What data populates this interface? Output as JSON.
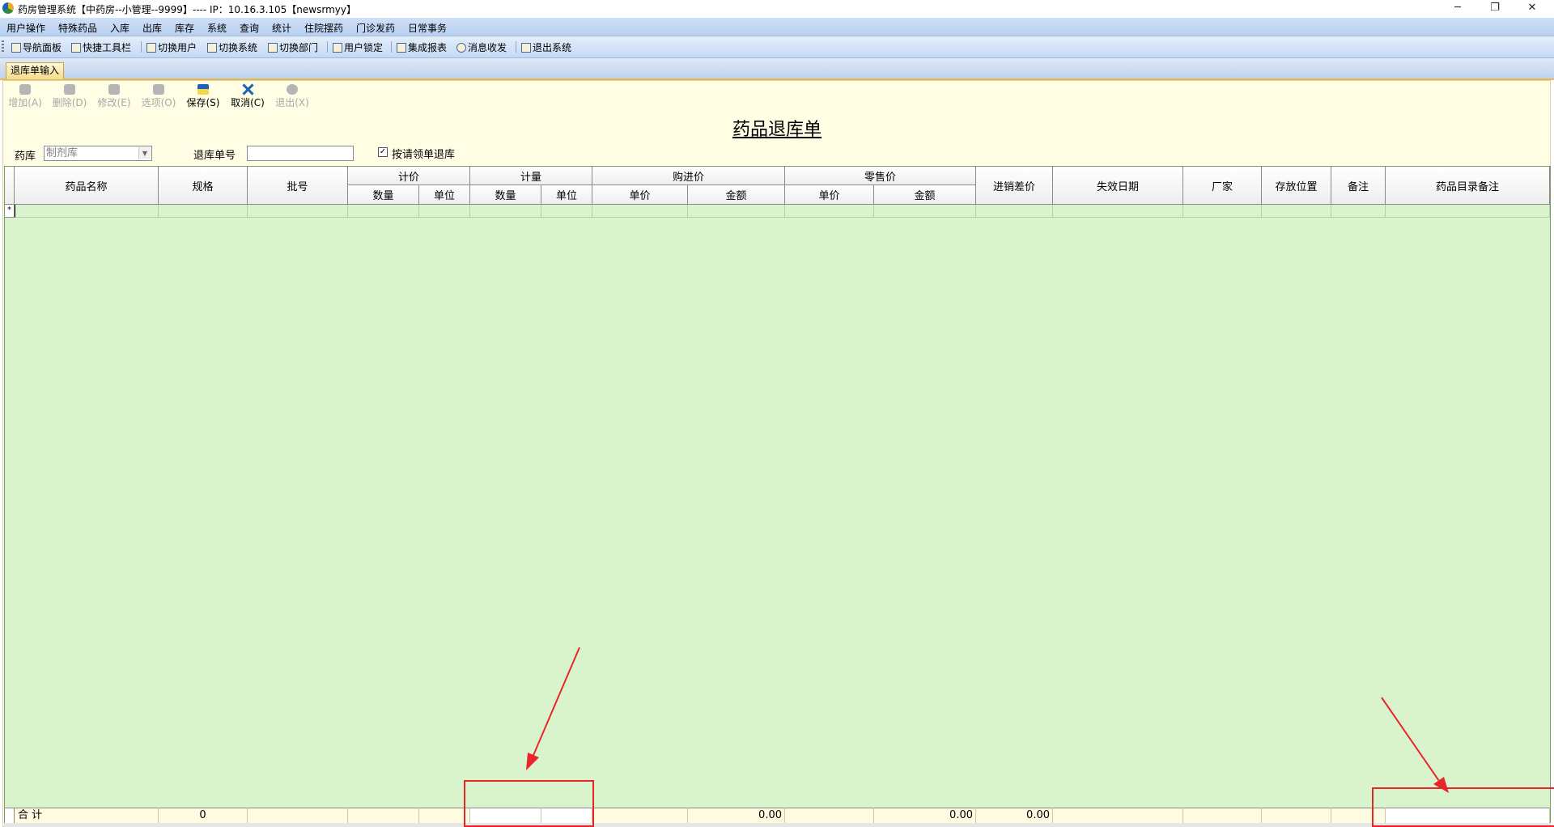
{
  "window": {
    "title": "药房管理系统【中药房--小管理--9999】---- IP：10.16.3.105【newsrmyy】",
    "controls": {
      "minimize": "─",
      "restore": "❐",
      "close": "✕"
    }
  },
  "menu": [
    "用户操作",
    "特殊药品",
    "入库",
    "出库",
    "库存",
    "系统",
    "查询",
    "统计",
    "住院摆药",
    "门诊发药",
    "日常事务"
  ],
  "toolbar": [
    "导航面板",
    "快捷工具栏",
    "切换用户",
    "切换系统",
    "切换部门",
    "用户锁定",
    "集成报表",
    "消息收发",
    "退出系统"
  ],
  "tab": {
    "label": "退库单输入"
  },
  "actions": [
    {
      "label": "增加(A)",
      "enabled": false
    },
    {
      "label": "删除(D)",
      "enabled": false
    },
    {
      "label": "修改(E)",
      "enabled": false
    },
    {
      "label": "选项(O)",
      "enabled": false
    },
    {
      "label": "保存(S)",
      "enabled": true
    },
    {
      "label": "取消(C)",
      "enabled": true
    },
    {
      "label": "退出(X)",
      "enabled": false
    }
  ],
  "form": {
    "title": "药品退库单",
    "pharmacy_label": "药库",
    "pharmacy_value": "制剂库",
    "return_no_label": "退库单号",
    "return_no_value": "",
    "by_request_label": "按请领单退库",
    "by_request_checked": true
  },
  "grid": {
    "headers": {
      "drug_name": "药品名称",
      "spec": "规格",
      "batch": "批号",
      "pricing": "计价",
      "pricing_qty": "数量",
      "pricing_unit": "单位",
      "measure": "计量",
      "measure_qty": "数量",
      "measure_unit": "单位",
      "purchase": "购进价",
      "purchase_price": "单价",
      "purchase_amount": "金额",
      "retail": "零售价",
      "retail_price": "单价",
      "retail_amount": "金额",
      "margin": "进销差价",
      "expiry": "失效日期",
      "maker": "厂家",
      "location": "存放位置",
      "remark": "备注",
      "catalog_remark": "药品目录备注"
    },
    "new_row_marker": "*",
    "totals": {
      "label": "合  计",
      "spec": "0",
      "purchase_amount": "0.00",
      "retail_amount": "0.00",
      "margin": "0.00"
    }
  },
  "colors": {
    "grid_bg": "#d9f4cc",
    "panel_bg": "#fffde4",
    "annotation": "#e8262a"
  }
}
